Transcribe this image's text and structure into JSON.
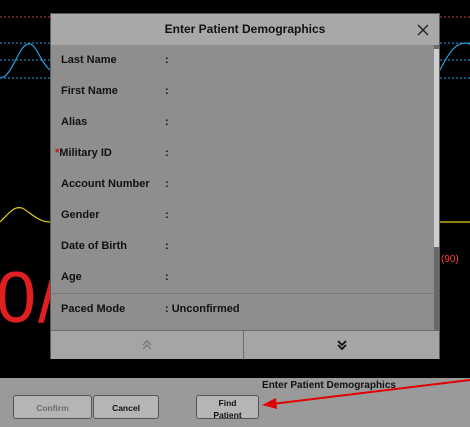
{
  "dialog": {
    "title": "Enter Patient Demographics",
    "fields": [
      {
        "label": "Last Name",
        "value": "",
        "required": false
      },
      {
        "label": "First Name",
        "value": "",
        "required": false
      },
      {
        "label": "Alias",
        "value": "",
        "required": false
      },
      {
        "label": "Military ID",
        "value": "",
        "required": true
      },
      {
        "label": "Account Number",
        "value": "",
        "required": false
      },
      {
        "label": "Gender",
        "value": "",
        "required": false
      },
      {
        "label": "Date of Birth",
        "value": "",
        "required": false
      },
      {
        "label": "Age",
        "value": "",
        "required": false
      },
      {
        "label": "Paced Mode",
        "value": "Unconfirmed",
        "required": false
      }
    ],
    "separator": ":",
    "required_marker": "*",
    "icons": {
      "close": "close-icon",
      "scroll_up": "chevron-up-icon",
      "scroll_down": "double-chevron-down-icon"
    }
  },
  "background": {
    "big_value": "0/",
    "right_value": "(90)"
  },
  "footer": {
    "title": "Enter Patient Demographics",
    "confirm_label": "Confirm",
    "cancel_label": "Cancel",
    "find_patient_line1": "Find",
    "find_patient_line2": "Patient"
  },
  "colors": {
    "required": "#d01010",
    "waveform_cyan": "#2aa0e0",
    "waveform_yellow": "#e0d020",
    "alarm_red": "#e02020",
    "annotation_arrow": "#e00000"
  }
}
